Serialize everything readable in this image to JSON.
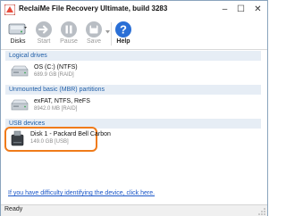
{
  "window": {
    "title": "ReclaiMe File Recovery Ultimate, build 3283",
    "minimize_glyph": "–",
    "maximize_glyph": "☐",
    "close_glyph": "✕"
  },
  "toolbar": {
    "disks_label": "Disks",
    "start_label": "Start",
    "pause_label": "Pause",
    "save_label": "Save",
    "help_label": "Help"
  },
  "groups": [
    {
      "header": "Logical drives",
      "drives": [
        {
          "name": "OS (C:) (NTFS)",
          "detail": "689.9 GB [RAID]",
          "icon": "hard-drive-icon"
        }
      ]
    },
    {
      "header": "Unmounted basic (MBR) partitions",
      "drives": [
        {
          "name": "exFAT, NTFS, ReFS",
          "detail": "8942.0 MB [RAID]",
          "icon": "hard-drive-icon"
        }
      ]
    },
    {
      "header": "USB devices",
      "drives": [
        {
          "name": "Disk 1 - Packard Bell Carbon",
          "detail": "149.0 GB [USB]",
          "icon": "usb-drive-icon",
          "selected": true
        }
      ]
    }
  ],
  "help_link": "If you have difficulty identifying the device, click here.",
  "status": "Ready",
  "colors": {
    "accent": "#1f5ea8",
    "selection_border": "#f07b1a",
    "help_button": "#2a6fd6"
  }
}
